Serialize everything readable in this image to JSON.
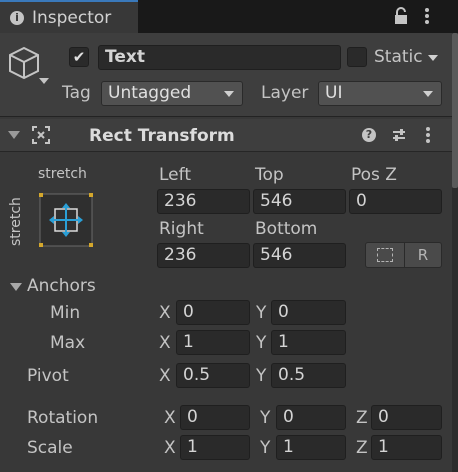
{
  "tab": {
    "icon": "info-icon",
    "title": "Inspector"
  },
  "tabbar_icons": [
    "lock-icon",
    "more-vertical-icon"
  ],
  "object": {
    "name": "Text",
    "active": true,
    "static_label": "Static",
    "tag_label": "Tag",
    "tag_value": "Untagged",
    "layer_label": "Layer",
    "layer_value": "UI"
  },
  "component": {
    "title": "Rect Transform",
    "preset_top": "stretch",
    "preset_side": "stretch",
    "labels": {
      "left": "Left",
      "top": "Top",
      "posz": "Pos Z",
      "right": "Right",
      "bottom": "Bottom"
    },
    "values": {
      "left": "236",
      "top": "546",
      "posz": "0",
      "right": "236",
      "bottom": "546"
    },
    "raw_button": "R",
    "anchors": {
      "label": "Anchors",
      "min_label": "Min",
      "max_label": "Max",
      "min": {
        "x": "0",
        "y": "0"
      },
      "max": {
        "x": "1",
        "y": "1"
      }
    },
    "pivot": {
      "label": "Pivot",
      "x": "0.5",
      "y": "0.5"
    },
    "rotation": {
      "label": "Rotation",
      "x": "0",
      "y": "0",
      "z": "0"
    },
    "scale": {
      "label": "Scale",
      "x": "1",
      "y": "1",
      "z": "1"
    },
    "axis_labels": {
      "x": "X",
      "y": "Y",
      "z": "Z"
    }
  },
  "colors": {
    "accent": "#3a79bb",
    "anchor": "#d4a72c",
    "handle": "#2a9fd6"
  }
}
